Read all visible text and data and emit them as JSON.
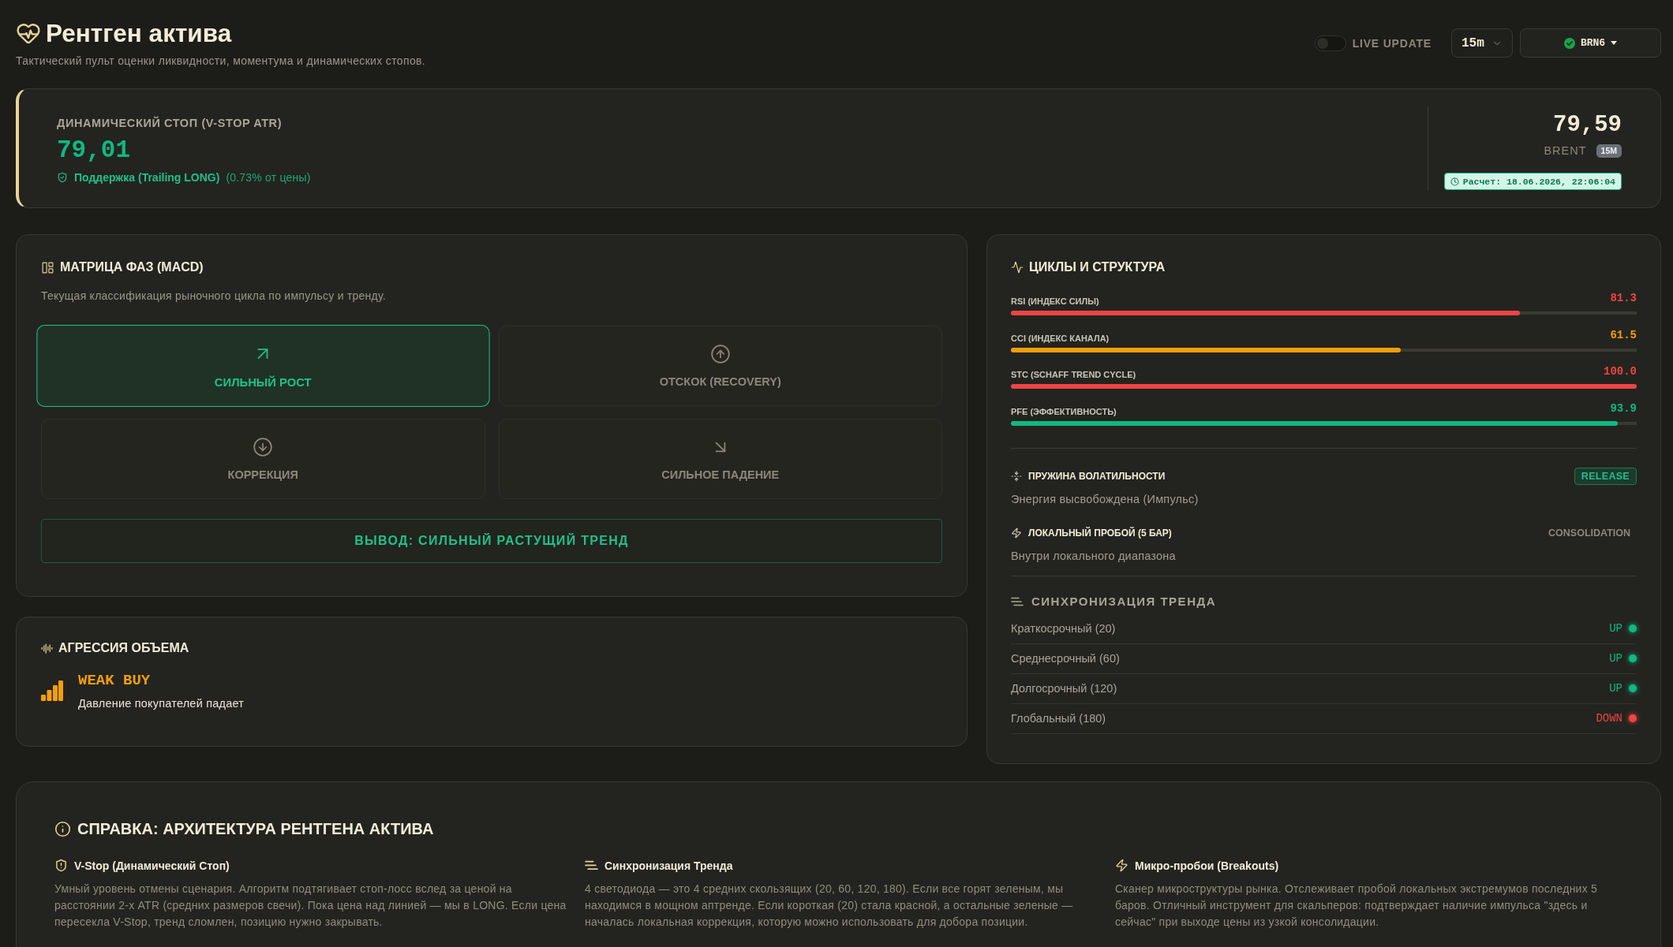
{
  "header": {
    "title": "Рентген актива",
    "subtitle": "Тактический пульт оценки ликвидности, моментума и динамических стопов.",
    "live_update": {
      "label": "LIVE UPDATE",
      "on": false
    },
    "timeframe": {
      "value": "15m"
    },
    "ticker": {
      "value": "BRN6",
      "connected": true
    }
  },
  "stop_card": {
    "label": "ДИНАМИЧЕСКИЙ СТОП (V-STOP ATR)",
    "value": "79,01",
    "support": "Поддержка (Trailing LONG)",
    "distance": "(0.73% от цены)",
    "price": "79,59",
    "symbol": "BRENT",
    "timeframe_badge": "15M",
    "calculated": "Расчет: 18.06.2026, 22:06:04"
  },
  "phase_matrix": {
    "title": "МАТРИЦА ФАЗ (MACD)",
    "description": "Текущая классификация рыночного цикла по импульсу и тренду.",
    "phases": [
      {
        "label": "СИЛЬНЫЙ РОСТ",
        "kind": "strong-up",
        "selected": true
      },
      {
        "label": "ОТСКОК (RECOVERY)",
        "kind": "recovery",
        "selected": false
      },
      {
        "label": "КОРРЕКЦИЯ",
        "kind": "correction",
        "selected": false
      },
      {
        "label": "СИЛЬНОЕ ПАДЕНИЕ",
        "kind": "strong-down",
        "selected": false
      }
    ],
    "verdict": "ВЫВОД: СИЛЬНЫЙ РАСТУЩИЙ ТРЕНД"
  },
  "volume": {
    "title": "АГРЕССИЯ ОБЪЕМА",
    "signal": "WEAK BUY",
    "description": "Давление покупателей падает"
  },
  "cycles": {
    "title": "ЦИКЛЫ И СТРУКТУРА",
    "metrics": [
      {
        "label": "RSI (ИНДЕКС СИЛЫ)",
        "reading": "81.3",
        "level": 0.813,
        "color": "#ef4444"
      },
      {
        "label": "CCI (ИНДЕКС КАНАЛА)",
        "reading": "61.5",
        "level": 0.623,
        "color": "#f59e0b"
      },
      {
        "label": "STC (SCHAFF TREND CYCLE)",
        "reading": "100.0",
        "level": 1.0,
        "color": "#ef4444"
      },
      {
        "label": "PFE (ЭФФЕКТИВНОСТЬ)",
        "reading": "93.9",
        "level": 0.97,
        "color": "#10b981"
      }
    ],
    "spring": {
      "title": "ПРУЖИНА ВОЛАТИЛЬНОСТИ",
      "badge": "RELEASE",
      "text": "Энергия высвобождена (Импульс)"
    },
    "breakout": {
      "title": "ЛОКАЛЬНЫЙ ПРОБОЙ (5 БАР)",
      "status": "CONSOLIDATION",
      "text": "Внутри локального диапазона"
    },
    "sync": {
      "title": "СИНХРОНИЗАЦИЯ ТРЕНДА",
      "rows": [
        {
          "label": "Краткосрочный (20)",
          "status": "UP",
          "color": "#10b981"
        },
        {
          "label": "Среднесрочный (60)",
          "status": "UP",
          "color": "#10b981"
        },
        {
          "label": "Долгосрочный (120)",
          "status": "UP",
          "color": "#10b981"
        },
        {
          "label": "Глобальный (180)",
          "status": "DOWN",
          "color": "#ef4444"
        }
      ]
    }
  },
  "help": {
    "title": "СПРАВКА: АРХИТЕКТУРА РЕНТГЕНА АКТИВА",
    "sections": [
      {
        "kind": "shield",
        "title": "V-Stop (Динамический Стоп)",
        "text": "Умный уровень отмены сценария. Алгоритм подтягивает стоп-лосс вслед за ценой на расстоянии 2-х ATR (средних размеров свечи). Пока цена над линией — мы в LONG. Если цена пересекла V-Stop, тренд сломлен, позицию нужно закрывать."
      },
      {
        "kind": "lines",
        "title": "Синхронизация Тренда",
        "text": "4 светодиода — это 4 средних скользящих (20, 60, 120, 180). Если все горят зеленым, мы находимся в мощном аптренде. Если короткая (20) стала красной, а остальные зеленые — началась локальная коррекция, которую можно использовать для добора позиции."
      },
      {
        "kind": "bolt",
        "title": "Микро-пробои (Breakouts)",
        "text": "Сканер микроструктуры рынка. Отслеживает пробой локальных экстремумов последних 5 баров. Отличный инструмент для скальперов: подтверждает наличие импульса \"здесь и сейчас\" при выходе цены из узкой консолидации."
      }
    ]
  }
}
